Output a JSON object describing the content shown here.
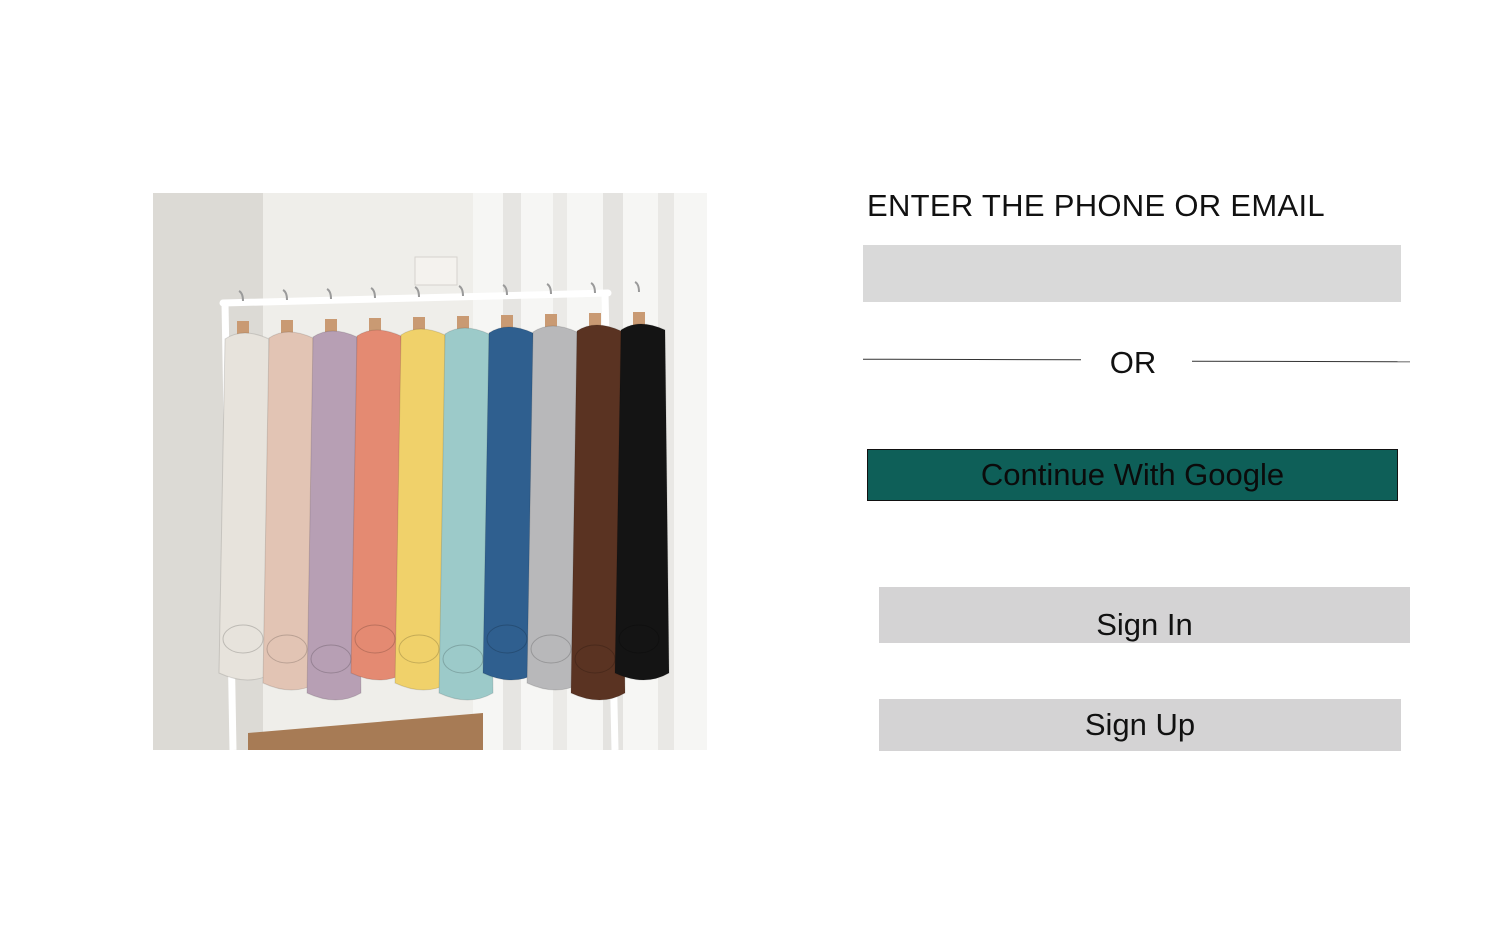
{
  "hero_image": {
    "subject": "hoodies-on-clothing-rack",
    "hoodie_colors": [
      "#e7e3dc",
      "#e2c4b4",
      "#b79fb4",
      "#e48a72",
      "#f0d16a",
      "#9ccac9",
      "#2f5f8f",
      "#b8b8ba",
      "#5a3322",
      "#141414"
    ]
  },
  "form": {
    "prompt_label": "ENTER THE PHONE OR EMAIL",
    "contact_value": "",
    "divider_text": "OR",
    "google_button_label": "Continue With Google",
    "signin_button_label": "Sign In",
    "signup_button_label": "Sign Up"
  },
  "colors": {
    "google_button_bg": "#0e5f58",
    "input_bg": "#d9d9d9",
    "secondary_button_bg": "#d4d3d4"
  }
}
